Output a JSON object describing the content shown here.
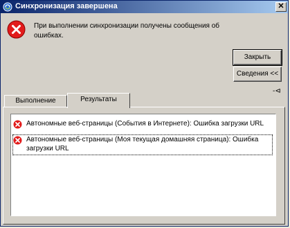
{
  "window": {
    "title": "Синхронизация завершена",
    "close_glyph": "✕"
  },
  "message": "При выполнении синхронизации получены сообщения об ошибках.",
  "buttons": {
    "close": "Закрыть",
    "details": "Сведения <<"
  },
  "pin_glyph": "-⊲",
  "tabs": [
    {
      "label": "Выполнение"
    },
    {
      "label": "Результаты"
    }
  ],
  "results": [
    {
      "text": "Автономные веб-страницы (События в Интернете): Ошибка загрузки URL",
      "icon": "error-icon"
    },
    {
      "text": "Автономные веб-страницы (Моя текущая домашняя страница): Ошибка загрузки URL",
      "icon": "error-icon"
    }
  ],
  "colors": {
    "error_red": "#e21b1b",
    "title_bar": "#0a246a"
  }
}
